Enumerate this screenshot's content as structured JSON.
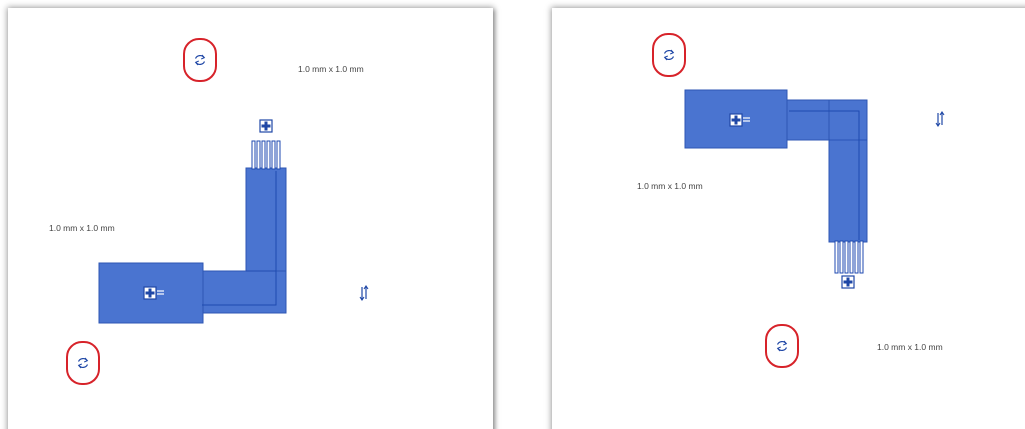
{
  "colors": {
    "part_fill": "#4a74d0",
    "part_stroke": "#2d56b3",
    "pin_line": "#1f4ab0",
    "highlight_ring": "#d7232a",
    "control_blue": "#1f47a6",
    "text": "#444444"
  },
  "icons": {
    "rotate": "rotate-icon",
    "flip": "flip-icon",
    "move": "move-cross-icon"
  },
  "views": [
    {
      "id": "left",
      "dimension_top": "1.0 mm x 1.0 mm",
      "dimension_side": "1.0 mm x 1.0 mm"
    },
    {
      "id": "right",
      "dimension_side": "1.0 mm x 1.0 mm",
      "dimension_bottom": "1.0 mm x 1.0 mm"
    }
  ]
}
